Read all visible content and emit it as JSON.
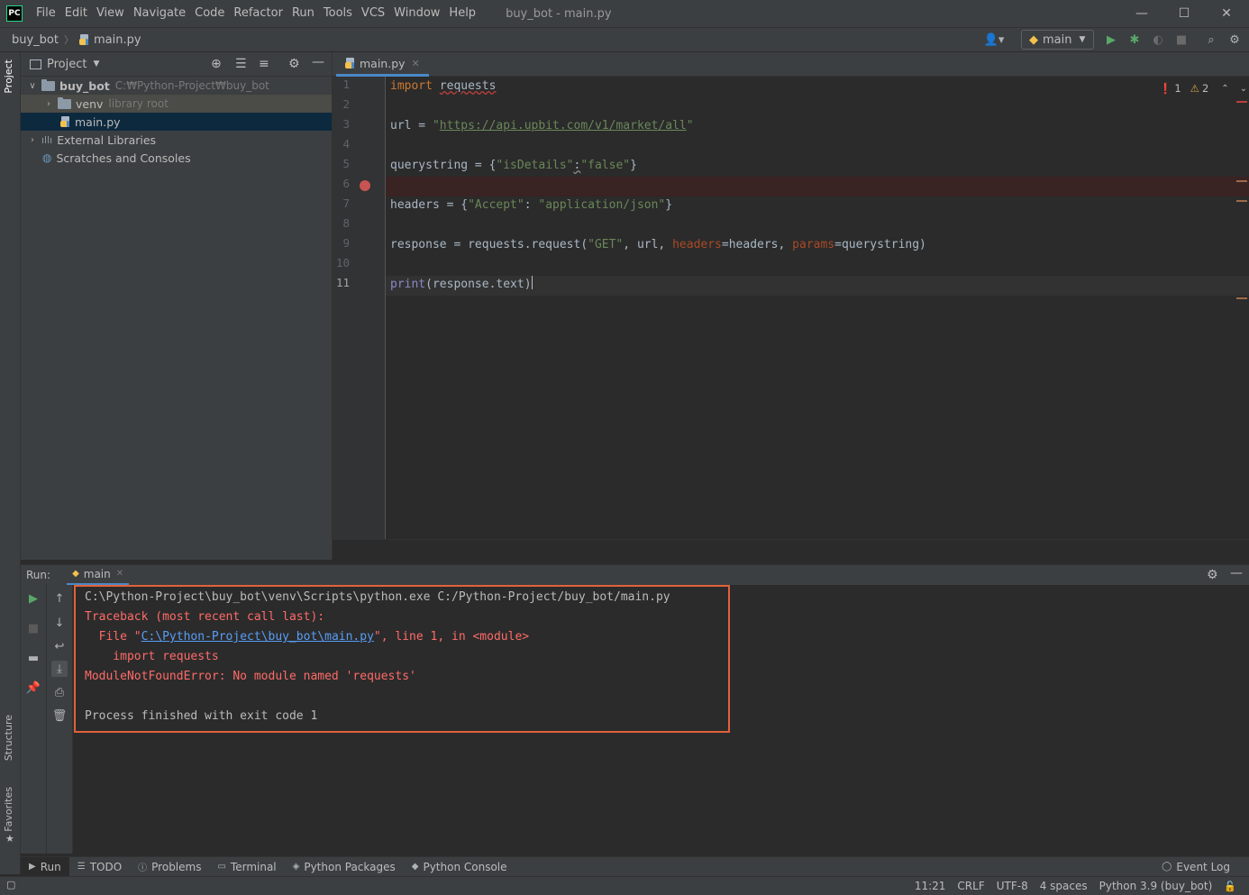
{
  "titlebar": {
    "logo": "PC",
    "menu": [
      "File",
      "Edit",
      "View",
      "Navigate",
      "Code",
      "Refactor",
      "Run",
      "Tools",
      "VCS",
      "Window",
      "Help"
    ],
    "window_title": "buy_bot - main.py",
    "controls": {
      "minimize": "—",
      "maximize": "☐",
      "close": "✕"
    }
  },
  "navbar": {
    "breadcrumb_project": "buy_bot",
    "breadcrumb_file": "main.py",
    "run_config": "main"
  },
  "left_stripe": {
    "project_tab": "Project",
    "structure_tab": "Structure",
    "favorites_tab": "Favorites"
  },
  "project_panel": {
    "title": "Project",
    "tree": [
      {
        "name": "buy_bot",
        "hint": "C:₩Python-Project₩buy_bot",
        "expanded": true
      },
      {
        "name": "venv",
        "hint": "library root",
        "expanded": false
      },
      {
        "name": "main.py",
        "selected": true
      },
      {
        "name": "External Libraries",
        "expanded": false
      },
      {
        "name": "Scratches and Consoles"
      }
    ]
  },
  "editor": {
    "tab_label": "main.py",
    "inspections": {
      "errors": "1",
      "warnings": "2"
    },
    "line_numbers": [
      "1",
      "2",
      "3",
      "4",
      "5",
      "6",
      "7",
      "8",
      "9",
      "10",
      "11"
    ],
    "breakpoint_line": "6",
    "code": {
      "l1_kw": "import",
      "l1_mod": "requests",
      "l3_var": "url = ",
      "l3_q1": "\"",
      "l3_url": "https://api.upbit.com/v1/market/all",
      "l3_q2": "\"",
      "l5_var": "querystring = {",
      "l5_key": "\"isDetails\"",
      "l5_colon": ":",
      "l5_val": "\"false\"",
      "l5_end": "}",
      "l7_var": "headers = {",
      "l7_key": "\"Accept\"",
      "l7_colon": ": ",
      "l7_val": "\"application/json\"",
      "l7_end": "}",
      "l9_a": "response = requests.request(",
      "l9_get": "\"GET\"",
      "l9_b": ", url, ",
      "l9_hp": "headers",
      "l9_c": "=headers, ",
      "l9_pp": "params",
      "l9_d": "=querystring)",
      "l11_fn": "print",
      "l11_rest": "(response.text)"
    }
  },
  "run_panel": {
    "label": "Run:",
    "tab": "main",
    "console": {
      "cmd": "C:\\Python-Project\\buy_bot\\venv\\Scripts\\python.exe C:/Python-Project/buy_bot/main.py",
      "traceback": "Traceback (most recent call last):",
      "file_prefix": "  File \"",
      "file_link": "C:\\Python-Project\\buy_bot\\main.py",
      "file_suffix": "\", line 1, in <module>",
      "import_line": "    import requests",
      "error": "ModuleNotFoundError: No module named 'requests'",
      "finished": "Process finished with exit code 1"
    }
  },
  "tool_windows": [
    "Run",
    "TODO",
    "Problems",
    "Terminal",
    "Python Packages",
    "Python Console"
  ],
  "event_log": "Event Log",
  "status_bar": {
    "position": "11:21",
    "line_sep": "CRLF",
    "encoding": "UTF-8",
    "indent": "4 spaces",
    "interpreter": "Python 3.9 (buy_bot)"
  },
  "colors": {
    "accent": "#4a88c7",
    "error": "#ff6b68",
    "highlight_box": "#e2603a",
    "run_green": "#59a869"
  }
}
